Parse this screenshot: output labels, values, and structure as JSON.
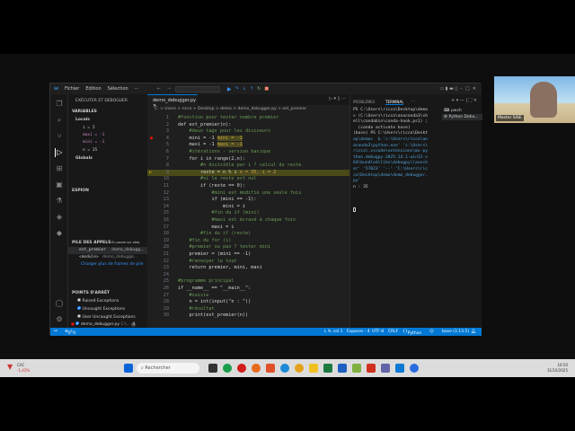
{
  "menu": [
    "Fichier",
    "Edition",
    "Sélection",
    "···"
  ],
  "sidebar": {
    "title": "EXÉCUTER ET DÉBOGUER",
    "variables": "VARIABLES",
    "locals": "Locals",
    "vars": [
      "i = 2",
      "maxi = -1",
      "mini = -1",
      "n = 35"
    ],
    "globals": "Globals",
    "watch": "ESPION",
    "callstack": "PILE DES APPELS",
    "paused": "En pause sur step",
    "frames": [
      {
        "name": "est_premier",
        "file": "demo_debugg..."
      },
      {
        "name": "<module>",
        "file": "demo_debugge..."
      }
    ],
    "load_more": "Charger plus de frames de pile",
    "breakpoints": "POINTS D'ARRÊT",
    "bps": [
      {
        "label": "Raised Exceptions",
        "checked": false
      },
      {
        "label": "Uncaught Exceptions",
        "checked": true
      },
      {
        "label": "User Uncaught Exceptions",
        "checked": false
      },
      {
        "label": "demo_debugger.py",
        "checked": true,
        "extra": "C:\\...",
        "count": "4"
      }
    ]
  },
  "editor": {
    "tab": "demo_debugger.py",
    "breadcrumb": "C: > Users > ricco > Desktop > demo > demo_debugger.py > est_premier",
    "lines": [
      {
        "n": "1",
        "t": "#fonction pour tester nombre premier",
        "c": true
      },
      {
        "n": "2",
        "t": "def est_premier(n):"
      },
      {
        "n": "3",
        "t": "    #deux tags pour les diviseurs",
        "c": true
      },
      {
        "n": "4",
        "t": "    mini = -1",
        "iv": "mini = -1",
        "bp": true
      },
      {
        "n": "5",
        "t": "    maxi = -1",
        "iv": "maxi = -1"
      },
      {
        "n": "6",
        "t": "    #itérations - version basique",
        "c": true
      },
      {
        "n": "7",
        "t": "    for i in range(2,n):"
      },
      {
        "n": "8",
        "t": "        #n divisible par i ? calcul du reste",
        "c": true
      },
      {
        "n": "9",
        "t": "        reste = n % i",
        "iv": "n = 35, i = 2",
        "cur": true
      },
      {
        "n": "10",
        "t": "        #si le reste est nul",
        "c": true
      },
      {
        "n": "11",
        "t": "        if (reste == 0):"
      },
      {
        "n": "12",
        "t": "            #mini est modifié une seule fois",
        "c": true
      },
      {
        "n": "13",
        "t": "            if (mini == -1):"
      },
      {
        "n": "14",
        "t": "                mini = i"
      },
      {
        "n": "15",
        "t": "            #fin du if (mini)",
        "c": true
      },
      {
        "n": "16",
        "t": "            #maxi est écrasé à chaque fois",
        "c": true
      },
      {
        "n": "17",
        "t": "            maxi = i"
      },
      {
        "n": "18",
        "t": "        #fin du if (reste)",
        "c": true
      },
      {
        "n": "19",
        "t": "    #fin du for (i)",
        "c": true
      },
      {
        "n": "20",
        "t": "    #premier ou pas ? tester mini",
        "c": true
      },
      {
        "n": "21",
        "t": "    premier = (mini == -1)"
      },
      {
        "n": "22",
        "t": "    #renvoyer le tout",
        "c": true
      },
      {
        "n": "23",
        "t": "    return premier, mini, maxi"
      },
      {
        "n": "24",
        "t": ""
      },
      {
        "n": "25",
        "t": "#programme principal",
        "c": true
      },
      {
        "n": "26",
        "t": "if __name__ == \"__main__\":"
      },
      {
        "n": "27",
        "t": "    #saisie",
        "c": true
      },
      {
        "n": "28",
        "t": "    n = int(input(\"n : \"))"
      },
      {
        "n": "29",
        "t": "    #résultat",
        "c": true
      },
      {
        "n": "30",
        "t": "    print(est_premier(n))"
      }
    ]
  },
  "panel": {
    "tabs": [
      "PROBLÈMES",
      "TERMINAL",
      "···"
    ],
    "terminals": [
      "pwsh",
      "Python Debu..."
    ],
    "lines": [
      "PS C:\\Users\\ricco\\Desktop\\demo",
      "> (C:\\Users\\ricco\\anaconda3\\sh",
      "ell\\condabin\\conda-hook.ps1) ;",
      "  (conda activate base)",
      "(base) PS C:\\Users\\ricco\\Deskt",
      "op\\demo>  & 'c:\\Users\\ricco\\an",
      "aconda3\\python.exe' 'c:\\Users\\",
      "ricco\\.vscode\\extensions\\ms-py",
      "thon.debugpy-2025.14.1-win32-x",
      "64\\bundled\\libs\\debugpy\\launch",
      "er' '57023' '--' 'C:\\Users\\ric",
      "co\\Desktop\\demo\\demo_debugger.",
      "py'",
      "n : 35"
    ]
  },
  "status": {
    "errors": "0",
    "warnings": "0",
    "pos": "L 9, col 1",
    "spaces": "Espaces : 4",
    "enc": "UTF-8",
    "eol": "CRLF",
    "lang": "Python",
    "env": "base (3.13.5)"
  },
  "taskbar": {
    "weather_label": "CAC",
    "weather_val": "-1,43%",
    "search": "Rechercher",
    "time": "16:50",
    "date": "31/10/2025"
  },
  "webcam": {
    "label": "Master SISE"
  }
}
